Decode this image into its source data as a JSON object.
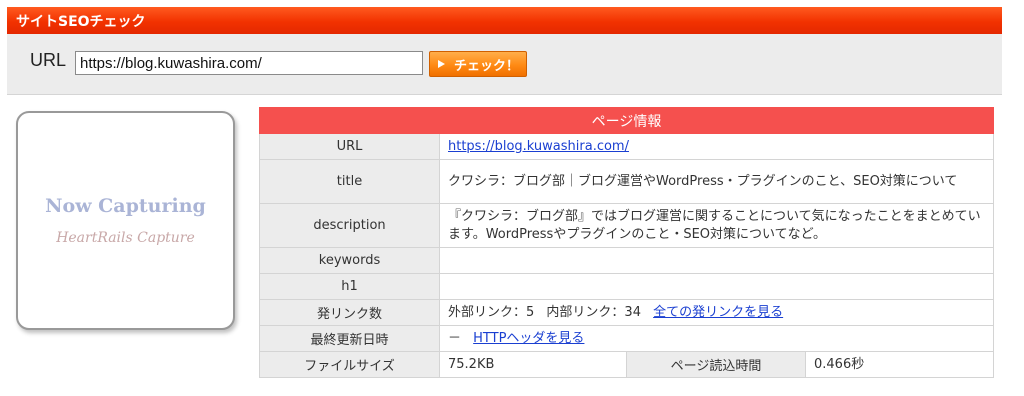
{
  "header": {
    "title": "サイトSEOチェック"
  },
  "form": {
    "url_label": "URL",
    "url_value": "https://blog.kuwashira.com/",
    "check_button_label": "チェック！"
  },
  "thumbnail": {
    "main_text": "Now Capturing",
    "sub_text": "HeartRails Capture"
  },
  "page_info": {
    "title": "ページ情報",
    "rows": {
      "url": {
        "label": "URL",
        "value": "https://blog.kuwashira.com/"
      },
      "title": {
        "label": "title",
        "value": "クワシラ：ブログ部｜ブログ運営やWordPress・プラグインのこと、SEO対策について"
      },
      "description": {
        "label": "description",
        "value": "『クワシラ：ブログ部』ではブログ運営に関することについて気になったことをまとめています。WordPressやプラグインのこと・SEO対策についてなど。"
      },
      "keywords": {
        "label": "keywords",
        "value": ""
      },
      "h1": {
        "label": "h1",
        "value": ""
      },
      "links": {
        "label": "発リンク数",
        "external": "外部リンク：5",
        "internal": "内部リンク：34",
        "all_links_link": "全ての発リンクを見る"
      },
      "last_modified": {
        "label": "最終更新日時",
        "value": "－",
        "http_header_link": "HTTPヘッダを見る"
      },
      "file_size": {
        "label": "ファイルサイズ",
        "value": "75.2KB",
        "load_time_label": "ページ読込時間",
        "load_time_value": "0.466秒"
      }
    }
  }
}
